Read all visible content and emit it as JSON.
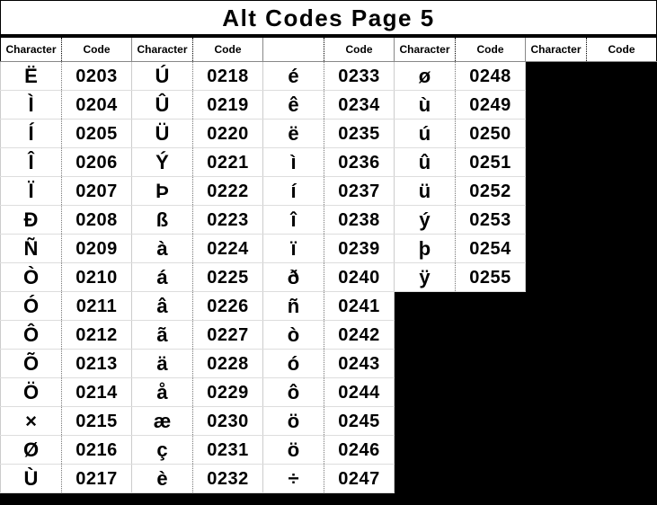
{
  "title": "Alt Codes Page 5",
  "headers": {
    "char": "Character",
    "code": "Code"
  },
  "columns": [
    [
      {
        "char": "Ë",
        "code": "0203"
      },
      {
        "char": "Ì",
        "code": "0204"
      },
      {
        "char": "Í",
        "code": "0205"
      },
      {
        "char": "Î",
        "code": "0206"
      },
      {
        "char": "Ï",
        "code": "0207"
      },
      {
        "char": "Ð",
        "code": "0208"
      },
      {
        "char": "Ñ",
        "code": "0209"
      },
      {
        "char": "Ò",
        "code": "0210"
      },
      {
        "char": "Ó",
        "code": "0211"
      },
      {
        "char": "Ô",
        "code": "0212"
      },
      {
        "char": "Õ",
        "code": "0213"
      },
      {
        "char": "Ö",
        "code": "0214"
      },
      {
        "char": "×",
        "code": "0215"
      },
      {
        "char": "Ø",
        "code": "0216"
      },
      {
        "char": "Ù",
        "code": "0217"
      }
    ],
    [
      {
        "char": "Ú",
        "code": "0218"
      },
      {
        "char": "Û",
        "code": "0219"
      },
      {
        "char": "Ü",
        "code": "0220"
      },
      {
        "char": "Ý",
        "code": "0221"
      },
      {
        "char": "Þ",
        "code": "0222"
      },
      {
        "char": "ß",
        "code": "0223"
      },
      {
        "char": "à",
        "code": "0224"
      },
      {
        "char": "á",
        "code": "0225"
      },
      {
        "char": "â",
        "code": "0226"
      },
      {
        "char": "ã",
        "code": "0227"
      },
      {
        "char": "ä",
        "code": "0228"
      },
      {
        "char": "å",
        "code": "0229"
      },
      {
        "char": "æ",
        "code": "0230"
      },
      {
        "char": "ç",
        "code": "0231"
      },
      {
        "char": "è",
        "code": "0232"
      }
    ],
    [
      {
        "char": "é",
        "code": "0233"
      },
      {
        "char": "ê",
        "code": "0234"
      },
      {
        "char": "ë",
        "code": "0235"
      },
      {
        "char": "ì",
        "code": "0236"
      },
      {
        "char": "í",
        "code": "0237"
      },
      {
        "char": "î",
        "code": "0238"
      },
      {
        "char": "ï",
        "code": "0239"
      },
      {
        "char": "ð",
        "code": "0240"
      },
      {
        "char": "ñ",
        "code": "0241"
      },
      {
        "char": "ò",
        "code": "0242"
      },
      {
        "char": "ó",
        "code": "0243"
      },
      {
        "char": "ô",
        "code": "0244"
      },
      {
        "char": "ö",
        "code": "0245"
      },
      {
        "char": "ö",
        "code": "0246"
      },
      {
        "char": "÷",
        "code": "0247"
      }
    ],
    [
      {
        "char": "ø",
        "code": "0248"
      },
      {
        "char": "ù",
        "code": "0249"
      },
      {
        "char": "ú",
        "code": "0250"
      },
      {
        "char": "û",
        "code": "0251"
      },
      {
        "char": "ü",
        "code": "0252"
      },
      {
        "char": "ý",
        "code": "0253"
      },
      {
        "char": "þ",
        "code": "0254"
      },
      {
        "char": "ÿ",
        "code": "0255"
      }
    ],
    []
  ]
}
